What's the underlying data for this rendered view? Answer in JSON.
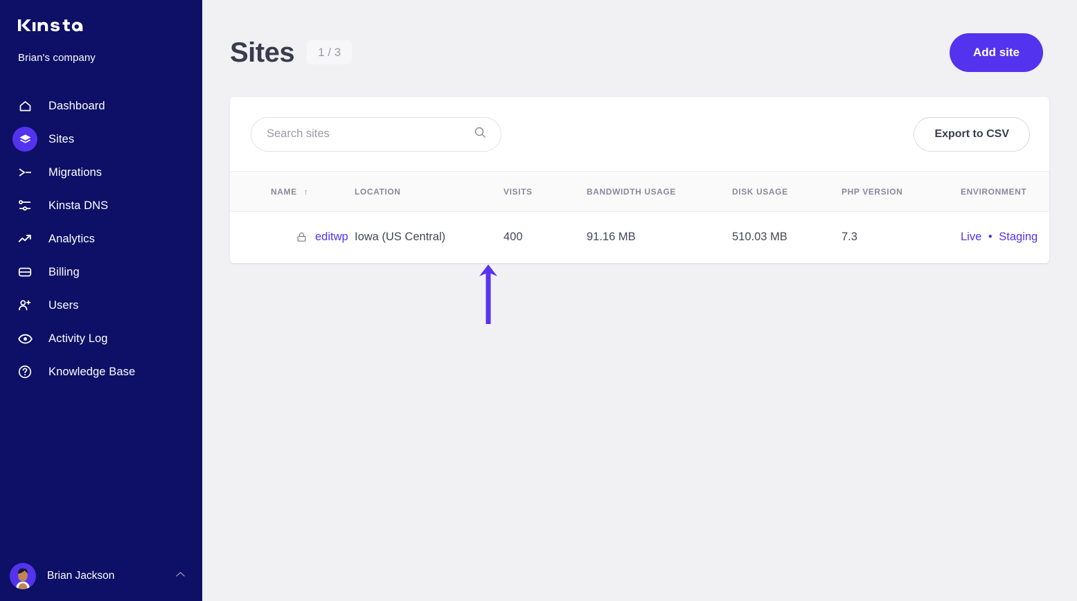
{
  "sidebar": {
    "logo_text": "KINSTA",
    "company": "Brian's company",
    "items": [
      {
        "label": "Dashboard",
        "icon": "home-icon",
        "active": false
      },
      {
        "label": "Sites",
        "icon": "layers-icon",
        "active": true
      },
      {
        "label": "Migrations",
        "icon": "migrations-icon",
        "active": false
      },
      {
        "label": "Kinsta DNS",
        "icon": "dns-icon",
        "active": false
      },
      {
        "label": "Analytics",
        "icon": "trend-up-icon",
        "active": false
      },
      {
        "label": "Billing",
        "icon": "card-icon",
        "active": false
      },
      {
        "label": "Users",
        "icon": "user-plus-icon",
        "active": false
      },
      {
        "label": "Activity Log",
        "icon": "eye-icon",
        "active": false
      },
      {
        "label": "Knowledge Base",
        "icon": "question-icon",
        "active": false
      }
    ],
    "user": {
      "name": "Brian Jackson",
      "avatar_icon": "avatar",
      "toggle_icon": "chevron-up-icon"
    }
  },
  "header": {
    "title": "Sites",
    "count_badge": "1 / 3",
    "add_site_label": "Add site"
  },
  "toolbar": {
    "search_placeholder": "Search sites",
    "search_value": "",
    "search_icon": "search-icon",
    "export_label": "Export to CSV"
  },
  "table": {
    "columns": [
      {
        "label": "NAME",
        "sort": "↑"
      },
      {
        "label": "LOCATION",
        "sort": ""
      },
      {
        "label": "VISITS",
        "sort": ""
      },
      {
        "label": "BANDWIDTH USAGE",
        "sort": ""
      },
      {
        "label": "DISK USAGE",
        "sort": ""
      },
      {
        "label": "PHP VERSION",
        "sort": ""
      },
      {
        "label": "ENVIRONMENT",
        "sort": ""
      }
    ],
    "rows": [
      {
        "lock_icon": "lock-icon",
        "name": "editwp",
        "location": "Iowa (US Central)",
        "visits": "400",
        "bandwidth": "91.16 MB",
        "disk": "510.03 MB",
        "php": "7.3",
        "env_live": "Live",
        "env_separator": "•",
        "env_staging": "Staging"
      }
    ]
  },
  "annotation": {
    "type": "arrow-up",
    "color": "#5a33ee"
  },
  "colors": {
    "sidebar_bg": "#0d1066",
    "accent": "#5333ed",
    "page_bg": "#f1f1f4",
    "card_bg": "#ffffff",
    "text_primary": "#45455a",
    "text_muted": "#8a8a99"
  }
}
